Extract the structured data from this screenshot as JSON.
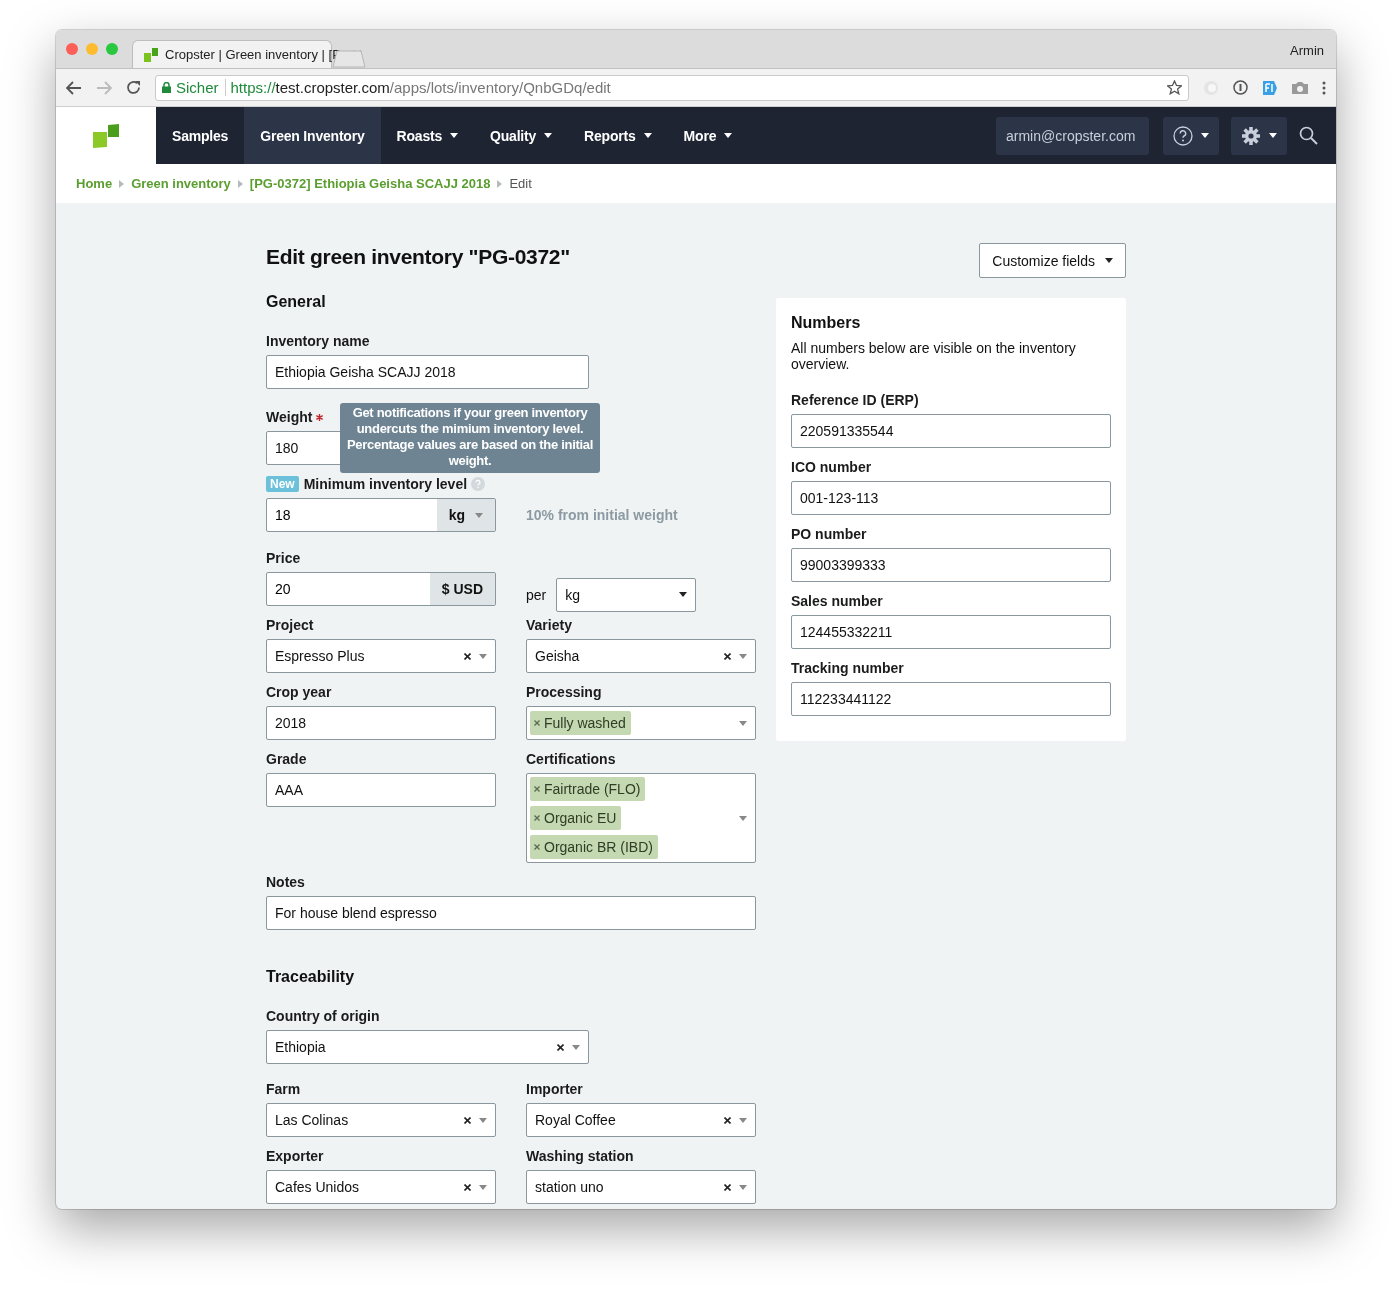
{
  "browser": {
    "tab_title": "Cropster | Green inventory | [P",
    "user": "Armin",
    "secure_label": "Sicher",
    "url_scheme": "https://",
    "url_host": "test.cropster.com",
    "url_path": "/apps/lots/inventory/QnbGDq/edit"
  },
  "nav": {
    "items": [
      {
        "label": "Samples",
        "selected": false,
        "dropdown": false
      },
      {
        "label": "Green Inventory",
        "selected": true,
        "dropdown": false
      },
      {
        "label": "Roasts",
        "selected": false,
        "dropdown": true
      },
      {
        "label": "Quality",
        "selected": false,
        "dropdown": true
      },
      {
        "label": "Reports",
        "selected": false,
        "dropdown": true
      },
      {
        "label": "More",
        "selected": false,
        "dropdown": true
      }
    ],
    "user_email": "armin@cropster.com"
  },
  "breadcrumb": [
    {
      "label": "Home",
      "kind": "link"
    },
    {
      "label": "Green inventory",
      "kind": "link"
    },
    {
      "label": "[PG-0372] Ethiopia Geisha SCAJJ 2018",
      "kind": "link"
    },
    {
      "label": "Edit",
      "kind": "current"
    }
  ],
  "page_title": "Edit green inventory \"PG-0372\"",
  "customize_button": "Customize fields",
  "general": {
    "heading": "General",
    "inventory_name": {
      "label": "Inventory name",
      "value": "Ethiopia Geisha SCAJJ 2018"
    },
    "weight": {
      "label": "Weight",
      "required": true,
      "value": "180"
    },
    "tooltip": "Get notifications if your green inventory undercuts the mimium inventory level. Percentage values are based on the initial weight.",
    "min_level": {
      "badge": "New",
      "label": "Minimum inventory level",
      "value": "18",
      "unit": "kg",
      "hint": "10% from initial weight"
    },
    "price": {
      "label": "Price",
      "value": "20",
      "currency": "$ USD",
      "per_label": "per",
      "per_unit": "kg"
    },
    "fields": [
      {
        "label": "Project",
        "kind": "select",
        "value": "Espresso Plus",
        "clearable": true
      },
      {
        "label": "Variety",
        "kind": "select",
        "value": "Geisha",
        "clearable": true
      },
      {
        "label": "Crop year",
        "kind": "text",
        "value": "2018"
      },
      {
        "label": "Processing",
        "kind": "tags",
        "tags": [
          "Fully washed"
        ]
      },
      {
        "label": "Grade",
        "kind": "text",
        "value": "AAA"
      },
      {
        "label": "Certifications",
        "kind": "tags",
        "tags": [
          "Fairtrade (FLO)",
          "Organic EU",
          "Organic BR (IBD)"
        ]
      }
    ],
    "notes": {
      "label": "Notes",
      "value": "For house blend espresso"
    }
  },
  "traceability": {
    "heading": "Traceability",
    "country": {
      "label": "Country of origin",
      "kind": "select",
      "value": "Ethiopia",
      "clearable": true
    },
    "fields": [
      {
        "label": "Farm",
        "kind": "select",
        "value": "Las Colinas",
        "clearable": true
      },
      {
        "label": "Importer",
        "kind": "select",
        "value": "Royal Coffee",
        "clearable": true
      },
      {
        "label": "Exporter",
        "kind": "select",
        "value": "Cafes Unidos",
        "clearable": true
      },
      {
        "label": "Washing station",
        "kind": "select",
        "value": "station uno",
        "clearable": true
      }
    ]
  },
  "numbers": {
    "heading": "Numbers",
    "description": "All numbers below are visible on the inventory overview.",
    "fields": [
      {
        "label": "Reference ID (ERP)",
        "value": "220591335544"
      },
      {
        "label": "ICO number",
        "value": "001-123-113"
      },
      {
        "label": "PO number",
        "value": "99003399333"
      },
      {
        "label": "Sales number",
        "value": "124455332211"
      },
      {
        "label": "Tracking number",
        "value": "112233441122"
      }
    ]
  }
}
